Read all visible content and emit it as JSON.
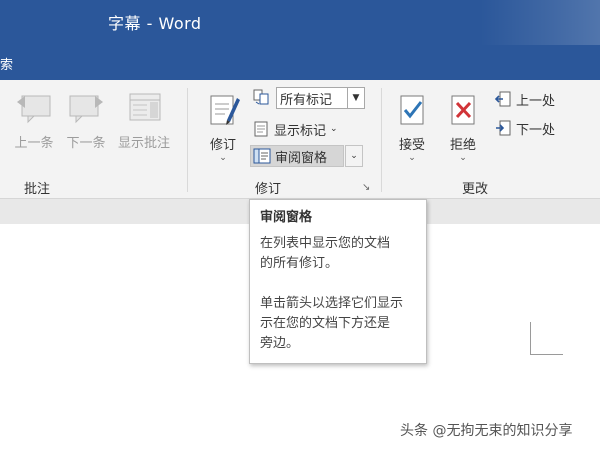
{
  "window": {
    "title": "字幕  -  Word"
  },
  "tabs": {
    "partial_tab": "索"
  },
  "ribbon": {
    "comments_group": {
      "label": "批注",
      "buttons": [
        {
          "label": "上一条",
          "icon": "previous-comment-icon",
          "enabled": false
        },
        {
          "label": "下一条",
          "icon": "next-comment-icon",
          "enabled": false
        },
        {
          "label": "显示批注",
          "icon": "show-comments-icon",
          "enabled": false
        }
      ]
    },
    "tracking_group": {
      "label": "修订",
      "track_changes": {
        "label": "修订",
        "icon": "track-changes-icon"
      },
      "markup_dropdown": {
        "value": "所有标记",
        "icon": "display-for-review-icon"
      },
      "show_markup": {
        "label": "显示标记",
        "icon": "show-markup-icon"
      },
      "reviewing_pane": {
        "label": "审阅窗格",
        "icon": "reviewing-pane-icon"
      }
    },
    "changes_group": {
      "label": "更改",
      "accept": {
        "label": "接受",
        "icon": "accept-icon"
      },
      "reject": {
        "label": "拒绝",
        "icon": "reject-icon"
      },
      "previous": {
        "label": "上一处",
        "icon": "previous-change-icon"
      },
      "next": {
        "label": "下一处",
        "icon": "next-change-icon"
      }
    }
  },
  "tooltip": {
    "title": "审阅窗格",
    "line1": "在列表中显示您的文档",
    "line2": "的所有修订。",
    "line3": "单击箭头以选择它们显示",
    "line4": "示在您的文档下方还是",
    "line5": "旁边。"
  },
  "watermark": "头条 @无拘无束的知识分享",
  "colors": {
    "titlebar": "#2b579a",
    "ribbon": "#f3f3f3",
    "accent_blue": "#2b579a",
    "reject_red": "#d13438",
    "accept_blue": "#2e75b6"
  }
}
